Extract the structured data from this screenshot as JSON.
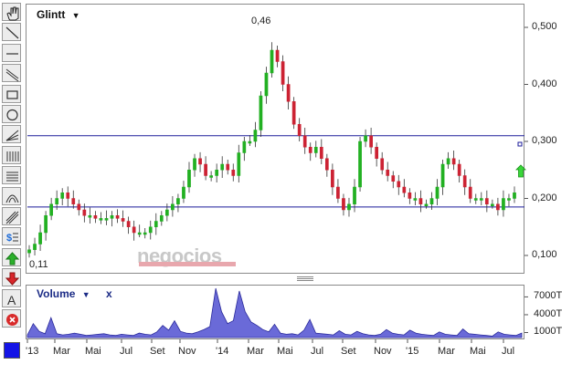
{
  "stock": {
    "name": "Glintt",
    "dropdown_icon": "triangle-down-icon"
  },
  "volume_panel": {
    "title": "Volume",
    "dropdown_icon": "triangle-down-icon",
    "close_label": "x"
  },
  "watermark": "negocios",
  "annotations": {
    "max": "0,46",
    "min": "0,11"
  },
  "price_axis": {
    "labels": [
      "0,500",
      "0,400",
      "0,300",
      "0,200",
      "0,100"
    ],
    "values": [
      0.5,
      0.4,
      0.3,
      0.2,
      0.1
    ]
  },
  "volume_axis": {
    "labels": [
      "7000T",
      "4000T",
      "1000T"
    ],
    "values": [
      7000,
      4000,
      1000
    ]
  },
  "x_axis": {
    "labels": [
      "'13",
      "Mar",
      "Mai",
      "Jul",
      "Set",
      "Nov",
      "'14",
      "Mar",
      "Mai",
      "Jul",
      "Set",
      "Nov",
      "'15",
      "Mar",
      "Mai",
      "Jul"
    ]
  },
  "horizontal_lines": [
    0.31,
    0.185
  ],
  "colors": {
    "up": "#22b022",
    "down": "#cc2233",
    "line": "#1b1b9a",
    "volume_fill": "#6a6ad8",
    "accent": "#1414e6"
  },
  "toolbar": {
    "icons": [
      "hand-icon",
      "diagonal-line-icon",
      "horizontal-line-icon",
      "parallel-lines-icon",
      "rectangle-icon",
      "circle-icon",
      "fan-icon",
      "vertical-lines-icon",
      "horizontal-grid-icon",
      "arc-icon",
      "channel-icon",
      "dollar-scale-icon",
      "buy-arrow-icon",
      "sell-arrow-icon",
      "text-icon",
      "delete-icon"
    ]
  },
  "chart_data": {
    "type": "candlestick",
    "period": "Jan 2013 - Jul 2015",
    "y_range": [
      0.07,
      0.52
    ],
    "price_close_series": [
      0.11,
      0.12,
      0.14,
      0.17,
      0.19,
      0.2,
      0.21,
      0.2,
      0.19,
      0.18,
      0.17,
      0.17,
      0.165,
      0.165,
      0.165,
      0.17,
      0.165,
      0.16,
      0.15,
      0.14,
      0.14,
      0.14,
      0.15,
      0.16,
      0.17,
      0.18,
      0.19,
      0.2,
      0.22,
      0.25,
      0.27,
      0.26,
      0.24,
      0.24,
      0.25,
      0.26,
      0.25,
      0.24,
      0.28,
      0.3,
      0.3,
      0.32,
      0.38,
      0.42,
      0.46,
      0.44,
      0.4,
      0.37,
      0.33,
      0.31,
      0.29,
      0.28,
      0.29,
      0.27,
      0.25,
      0.22,
      0.2,
      0.18,
      0.19,
      0.22,
      0.3,
      0.31,
      0.29,
      0.27,
      0.25,
      0.24,
      0.23,
      0.22,
      0.21,
      0.2,
      0.2,
      0.19,
      0.19,
      0.2,
      0.22,
      0.26,
      0.27,
      0.26,
      0.24,
      0.22,
      0.2,
      0.2,
      0.2,
      0.19,
      0.19,
      0.18,
      0.2,
      0.2,
      0.21
    ],
    "volume_thousands": [
      600,
      2500,
      1200,
      800,
      3500,
      800,
      600,
      700,
      900,
      700,
      500,
      600,
      700,
      800,
      600,
      500,
      700,
      600,
      500,
      900,
      700,
      600,
      1100,
      2200,
      1400,
      3000,
      1200,
      900,
      800,
      1100,
      1500,
      2000,
      9600,
      4500,
      2500,
      3000,
      8000,
      4500,
      2800,
      2200,
      1500,
      1100,
      2400,
      900,
      700,
      800,
      600,
      1400,
      3200,
      900,
      800,
      700,
      600,
      1300,
      700,
      600,
      1200,
      800,
      600,
      500,
      700,
      1500,
      900,
      700,
      600,
      1400,
      900,
      700,
      600,
      500,
      1100,
      700,
      600,
      500,
      1600,
      800,
      700,
      600,
      500,
      400,
      1100,
      700,
      600,
      500,
      900
    ],
    "ylabel_volume": "Volume"
  }
}
